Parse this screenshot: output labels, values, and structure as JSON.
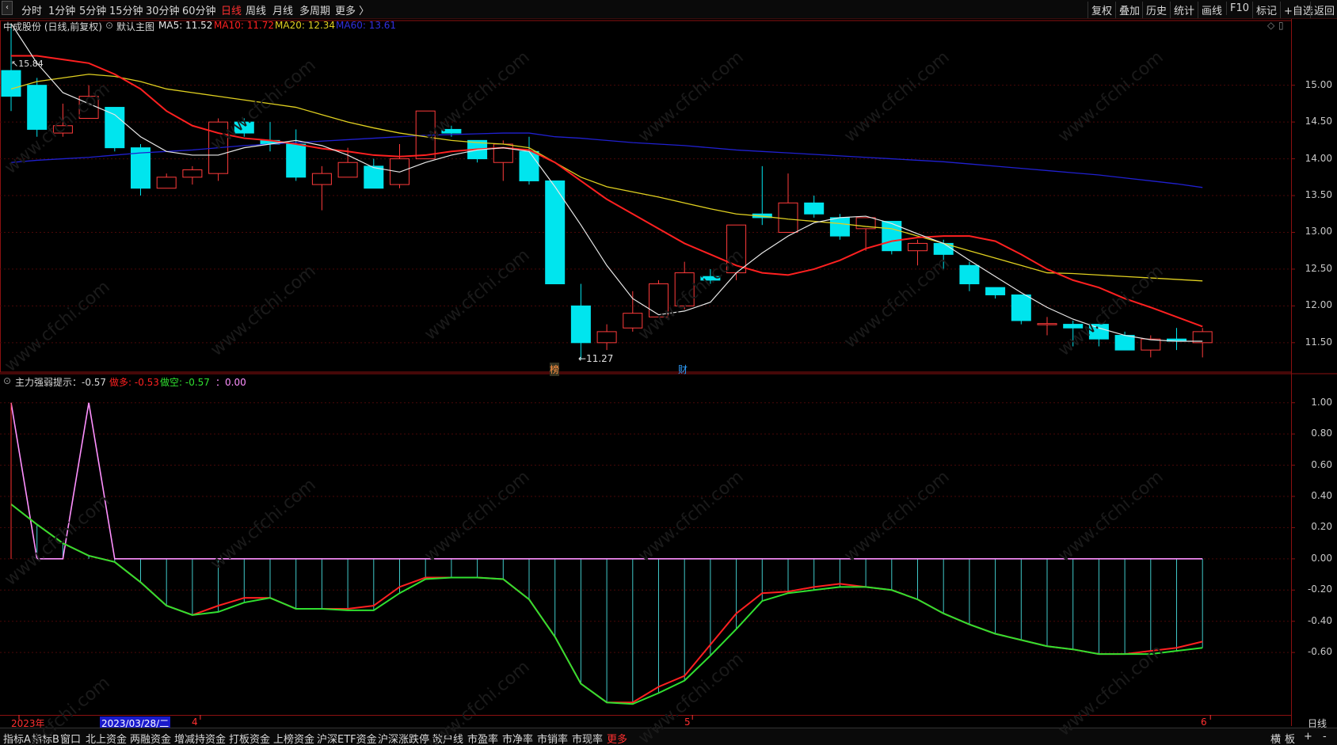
{
  "toolbar": {
    "periods": [
      "分时",
      "1分钟",
      "5分钟",
      "15分钟",
      "30分钟",
      "60分钟",
      "日线",
      "周线",
      "月线",
      "多周期",
      "更多 〉"
    ],
    "active_period": "日线",
    "actions": [
      "复权",
      "叠加",
      "历史",
      "统计",
      "画线",
      "F10",
      "标记",
      "+自选",
      "返回"
    ]
  },
  "main_header": {
    "stock": "中成股份 (日线,前复权)",
    "template": "默认主图",
    "ma5": "MA5: 11.52",
    "ma10": "MA10: 11.72",
    "ma20": "MA20: 12.34",
    "ma60": "MA60: 13.61"
  },
  "sub_header": {
    "name": "主力强弱提示：-0.57",
    "duo": "做多: -0.53",
    "kong": "做空: -0.57",
    "extra": "：0.00"
  },
  "annotations": {
    "high": "15.84",
    "low": "←11.27",
    "bang": "榜",
    "cai": "财"
  },
  "price_axis": [
    "15.00",
    "14.50",
    "14.00",
    "13.50",
    "13.00",
    "12.50",
    "12.00",
    "11.50"
  ],
  "indicator_axis": [
    "1.00",
    "0.80",
    "0.60",
    "0.40",
    "0.20",
    "0.00",
    "-0.20",
    "-0.40",
    "-0.60"
  ],
  "date_axis": {
    "year": "2023年",
    "cursor_date": "2023/03/28/二",
    "m4": "4",
    "m5": "5",
    "m6": "6",
    "period_label": "日线"
  },
  "bottom_tabs": [
    "指标A",
    "指标B",
    "窗口",
    "北上资金",
    "两融资金",
    "增减持资金",
    "打板资金",
    "上榜资金",
    "沪深ETF资金",
    "沪深涨跌停",
    "散户线",
    "市盈率",
    "市净率",
    "市销率",
    "市现率",
    "更多"
  ],
  "bottom_right": [
    "横",
    "板",
    "+",
    "-"
  ],
  "watermark": "www.cfchi.com",
  "colors": {
    "up": "#ff3b3b",
    "down": "#00e5ee",
    "ma5": "#e8e8e8",
    "ma10": "#ff2020",
    "ma20": "#e0d020",
    "ma60": "#2020d0",
    "duo": "#ff2020",
    "kong": "#30e030",
    "pink": "#ff90ff"
  },
  "chart_data": {
    "type": "candlestick",
    "candles": [
      {
        "o": 15.2,
        "h": 15.84,
        "l": 14.65,
        "c": 14.85
      },
      {
        "o": 15.0,
        "h": 15.1,
        "l": 14.3,
        "c": 14.4
      },
      {
        "o": 14.35,
        "h": 14.75,
        "l": 14.3,
        "c": 14.45
      },
      {
        "o": 14.55,
        "h": 15.0,
        "l": 14.55,
        "c": 14.85
      },
      {
        "o": 14.7,
        "h": 14.7,
        "l": 14.1,
        "c": 14.15
      },
      {
        "o": 14.15,
        "h": 14.2,
        "l": 13.5,
        "c": 13.6
      },
      {
        "o": 13.6,
        "h": 13.8,
        "l": 13.6,
        "c": 13.75
      },
      {
        "o": 13.75,
        "h": 13.9,
        "l": 13.65,
        "c": 13.85
      },
      {
        "o": 13.8,
        "h": 14.55,
        "l": 13.7,
        "c": 14.5
      },
      {
        "o": 14.5,
        "h": 14.55,
        "l": 14.3,
        "c": 14.35
      },
      {
        "o": 14.25,
        "h": 14.5,
        "l": 14.1,
        "c": 14.2
      },
      {
        "o": 14.2,
        "h": 14.4,
        "l": 13.7,
        "c": 13.75
      },
      {
        "o": 13.65,
        "h": 13.9,
        "l": 13.3,
        "c": 13.8
      },
      {
        "o": 13.75,
        "h": 14.15,
        "l": 13.75,
        "c": 13.95
      },
      {
        "o": 13.9,
        "h": 14.0,
        "l": 13.6,
        "c": 13.6
      },
      {
        "o": 13.65,
        "h": 14.2,
        "l": 13.6,
        "c": 14.0
      },
      {
        "o": 14.0,
        "h": 14.65,
        "l": 14.0,
        "c": 14.65
      },
      {
        "o": 14.4,
        "h": 14.45,
        "l": 14.3,
        "c": 14.35
      },
      {
        "o": 14.25,
        "h": 14.25,
        "l": 13.95,
        "c": 14.0
      },
      {
        "o": 13.95,
        "h": 14.25,
        "l": 13.7,
        "c": 14.2
      },
      {
        "o": 14.1,
        "h": 14.3,
        "l": 13.65,
        "c": 13.7
      },
      {
        "o": 13.7,
        "h": 13.7,
        "l": 12.3,
        "c": 12.3
      },
      {
        "o": 12.0,
        "h": 12.3,
        "l": 11.27,
        "c": 11.5
      },
      {
        "o": 11.5,
        "h": 11.75,
        "l": 11.4,
        "c": 11.65
      },
      {
        "o": 11.7,
        "h": 12.2,
        "l": 11.65,
        "c": 11.9
      },
      {
        "o": 11.85,
        "h": 12.35,
        "l": 11.85,
        "c": 12.3
      },
      {
        "o": 12.0,
        "h": 12.6,
        "l": 11.95,
        "c": 12.45
      },
      {
        "o": 12.4,
        "h": 12.5,
        "l": 12.3,
        "c": 12.35
      },
      {
        "o": 12.45,
        "h": 13.0,
        "l": 12.35,
        "c": 13.1
      },
      {
        "o": 13.25,
        "h": 13.9,
        "l": 13.1,
        "c": 13.2
      },
      {
        "o": 13.0,
        "h": 13.8,
        "l": 13.0,
        "c": 13.4
      },
      {
        "o": 13.4,
        "h": 13.5,
        "l": 13.2,
        "c": 13.25
      },
      {
        "o": 13.2,
        "h": 13.25,
        "l": 12.9,
        "c": 12.95
      },
      {
        "o": 13.05,
        "h": 13.2,
        "l": 12.75,
        "c": 13.2
      },
      {
        "o": 13.15,
        "h": 13.15,
        "l": 12.7,
        "c": 12.75
      },
      {
        "o": 12.75,
        "h": 12.9,
        "l": 12.55,
        "c": 12.85
      },
      {
        "o": 12.85,
        "h": 12.9,
        "l": 12.5,
        "c": 12.7
      },
      {
        "o": 12.55,
        "h": 12.6,
        "l": 12.2,
        "c": 12.3
      },
      {
        "o": 12.25,
        "h": 12.25,
        "l": 12.1,
        "c": 12.15
      },
      {
        "o": 12.15,
        "h": 12.15,
        "l": 11.75,
        "c": 11.8
      },
      {
        "o": 11.75,
        "h": 11.85,
        "l": 11.6,
        "c": 11.76
      },
      {
        "o": 11.75,
        "h": 11.8,
        "l": 11.45,
        "c": 11.7
      },
      {
        "o": 11.75,
        "h": 11.75,
        "l": 11.45,
        "c": 11.55
      },
      {
        "o": 11.6,
        "h": 11.65,
        "l": 11.4,
        "c": 11.4
      },
      {
        "o": 11.4,
        "h": 11.6,
        "l": 11.3,
        "c": 11.55
      },
      {
        "o": 11.55,
        "h": 11.7,
        "l": 11.4,
        "c": 11.52
      },
      {
        "o": 11.5,
        "h": 11.7,
        "l": 11.3,
        "c": 11.65
      }
    ],
    "ma5": [
      15.84,
      15.3,
      14.9,
      14.75,
      14.6,
      14.3,
      14.1,
      14.05,
      14.05,
      14.15,
      14.2,
      14.25,
      14.18,
      14.05,
      13.88,
      13.82,
      13.95,
      14.05,
      14.12,
      14.15,
      14.1,
      13.62,
      13.1,
      12.55,
      12.1,
      11.88,
      11.93,
      12.05,
      12.45,
      12.72,
      12.95,
      13.13,
      13.2,
      13.22,
      13.12,
      12.98,
      12.85,
      12.62,
      12.4,
      12.18,
      11.98,
      11.82,
      11.7,
      11.6,
      11.54,
      11.52,
      11.52
    ],
    "ma10": [
      15.4,
      15.4,
      15.35,
      15.3,
      15.15,
      14.95,
      14.65,
      14.45,
      14.35,
      14.28,
      14.25,
      14.2,
      14.14,
      14.1,
      14.05,
      14.03,
      14.05,
      14.1,
      14.13,
      14.15,
      14.12,
      13.95,
      13.7,
      13.45,
      13.25,
      13.05,
      12.85,
      12.7,
      12.55,
      12.45,
      12.42,
      12.5,
      12.62,
      12.78,
      12.88,
      12.93,
      12.95,
      12.95,
      12.88,
      12.7,
      12.5,
      12.35,
      12.25,
      12.1,
      11.98,
      11.85,
      11.72
    ],
    "ma20": [
      14.95,
      15.05,
      15.1,
      15.15,
      15.12,
      15.05,
      14.95,
      14.9,
      14.85,
      14.8,
      14.75,
      14.7,
      14.6,
      14.5,
      14.42,
      14.35,
      14.3,
      14.25,
      14.22,
      14.2,
      14.15,
      13.95,
      13.75,
      13.62,
      13.55,
      13.48,
      13.4,
      13.32,
      13.25,
      13.22,
      13.18,
      13.15,
      13.12,
      13.08,
      13.05,
      12.95,
      12.85,
      12.75,
      12.65,
      12.55,
      12.45,
      12.44,
      12.42,
      12.4,
      12.38,
      12.36,
      12.34
    ],
    "ma60": [
      13.95,
      13.98,
      14.0,
      14.02,
      14.05,
      14.08,
      14.1,
      14.12,
      14.15,
      14.18,
      14.2,
      14.22,
      14.24,
      14.26,
      14.28,
      14.3,
      14.32,
      14.33,
      14.34,
      14.35,
      14.35,
      14.3,
      14.28,
      14.25,
      14.22,
      14.2,
      14.18,
      14.15,
      14.12,
      14.1,
      14.08,
      14.06,
      14.04,
      14.02,
      14.0,
      13.98,
      13.96,
      13.93,
      13.9,
      13.87,
      13.84,
      13.81,
      13.78,
      13.74,
      13.7,
      13.66,
      13.61
    ],
    "duo": [
      0.35,
      0.22,
      0.1,
      0.02,
      -0.02,
      -0.15,
      -0.3,
      -0.36,
      -0.3,
      -0.25,
      -0.25,
      -0.32,
      -0.32,
      -0.32,
      -0.3,
      -0.18,
      -0.12,
      -0.12,
      -0.12,
      -0.13,
      -0.26,
      -0.5,
      -0.8,
      -0.92,
      -0.92,
      -0.82,
      -0.75,
      -0.55,
      -0.35,
      -0.22,
      -0.21,
      -0.18,
      -0.16,
      -0.18,
      -0.2,
      -0.26,
      -0.35,
      -0.42,
      -0.48,
      -0.52,
      -0.56,
      -0.58,
      -0.61,
      -0.61,
      -0.59,
      -0.57,
      -0.53
    ],
    "kong": [
      0.35,
      0.22,
      0.1,
      0.02,
      -0.02,
      -0.15,
      -0.3,
      -0.36,
      -0.34,
      -0.28,
      -0.25,
      -0.32,
      -0.32,
      -0.33,
      -0.33,
      -0.22,
      -0.13,
      -0.12,
      -0.12,
      -0.13,
      -0.26,
      -0.5,
      -0.8,
      -0.92,
      -0.93,
      -0.86,
      -0.78,
      -0.62,
      -0.45,
      -0.27,
      -0.22,
      -0.2,
      -0.18,
      -0.18,
      -0.2,
      -0.26,
      -0.35,
      -0.42,
      -0.48,
      -0.52,
      -0.56,
      -0.58,
      -0.61,
      -0.61,
      -0.61,
      -0.59,
      -0.57
    ],
    "pink": [
      1.0,
      0.0,
      0.0,
      1.0,
      0.0,
      0.0,
      0.0,
      0.0,
      0.0,
      0.0,
      0.0,
      0.0,
      0.0,
      0.0,
      0.0,
      0.0,
      0.0,
      0.0,
      0.0,
      0.0,
      0.0,
      0.0,
      0.0,
      0.0,
      0.0,
      0.0,
      0.0,
      0.0,
      0.0,
      0.0,
      0.0,
      0.0,
      0.0,
      0.0,
      0.0,
      0.0,
      0.0,
      0.0,
      0.0,
      0.0,
      0.0,
      0.0,
      0.0,
      0.0,
      0.0,
      0.0,
      0.0
    ],
    "price_range": [
      11.1,
      15.75
    ],
    "indicator_range": [
      -1.0,
      1.1
    ]
  }
}
